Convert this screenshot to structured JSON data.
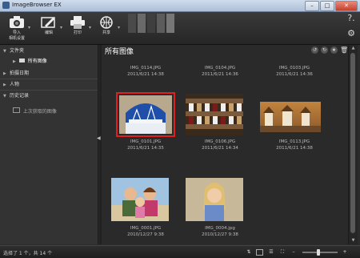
{
  "window": {
    "title": "ImageBrowser EX",
    "min_label": "–",
    "max_label": "□",
    "close_label": "✕"
  },
  "toolbar": {
    "tools": [
      {
        "label1": "导入",
        "label2": "相机设置",
        "icon": "camera-icon"
      },
      {
        "label1": "编辑",
        "label2": "",
        "icon": "edit-icon"
      },
      {
        "label1": "打印",
        "label2": "",
        "icon": "printer-icon"
      },
      {
        "label1": "共享",
        "label2": "",
        "icon": "share-icon"
      }
    ],
    "help_label": "?.",
    "settings_icon": "gear-icon"
  },
  "sidebar": {
    "folder_header": "文件夹",
    "all_images": "所有图像",
    "date_header": "拍摄日期",
    "people_header": "人物",
    "history_header": "历史记录",
    "last_imported": "上次获取的图像"
  },
  "main": {
    "title": "所有图像",
    "thumbnails": [
      {
        "name": "IMG_0114.JPG",
        "date": "2011/6/21 14:38"
      },
      {
        "name": "IMG_0104.JPG",
        "date": "2011/6/21 14:36"
      },
      {
        "name": "IMG_0103.JPG",
        "date": "2011/6/21 14:36"
      },
      {
        "name": "IMG_0101.JPG",
        "date": "2011/6/21 14:35"
      },
      {
        "name": "IMG_0106.JPG",
        "date": "2011/6/21 14:34"
      },
      {
        "name": "IMG_0113.JPG",
        "date": "2011/6/21 14:38"
      },
      {
        "name": "IMG_0001.JPG",
        "date": "2010/12/27 9:38"
      },
      {
        "name": "IMG_0004.jpg",
        "date": "2010/12/27 9:38"
      }
    ]
  },
  "status": {
    "text": "选择了 1 个，共 14 个",
    "zoom_out": "–",
    "zoom_in": "+",
    "zoom_level": 0.45
  },
  "colors": {
    "selection": "#e02020",
    "accent": "#3a5f8f"
  }
}
